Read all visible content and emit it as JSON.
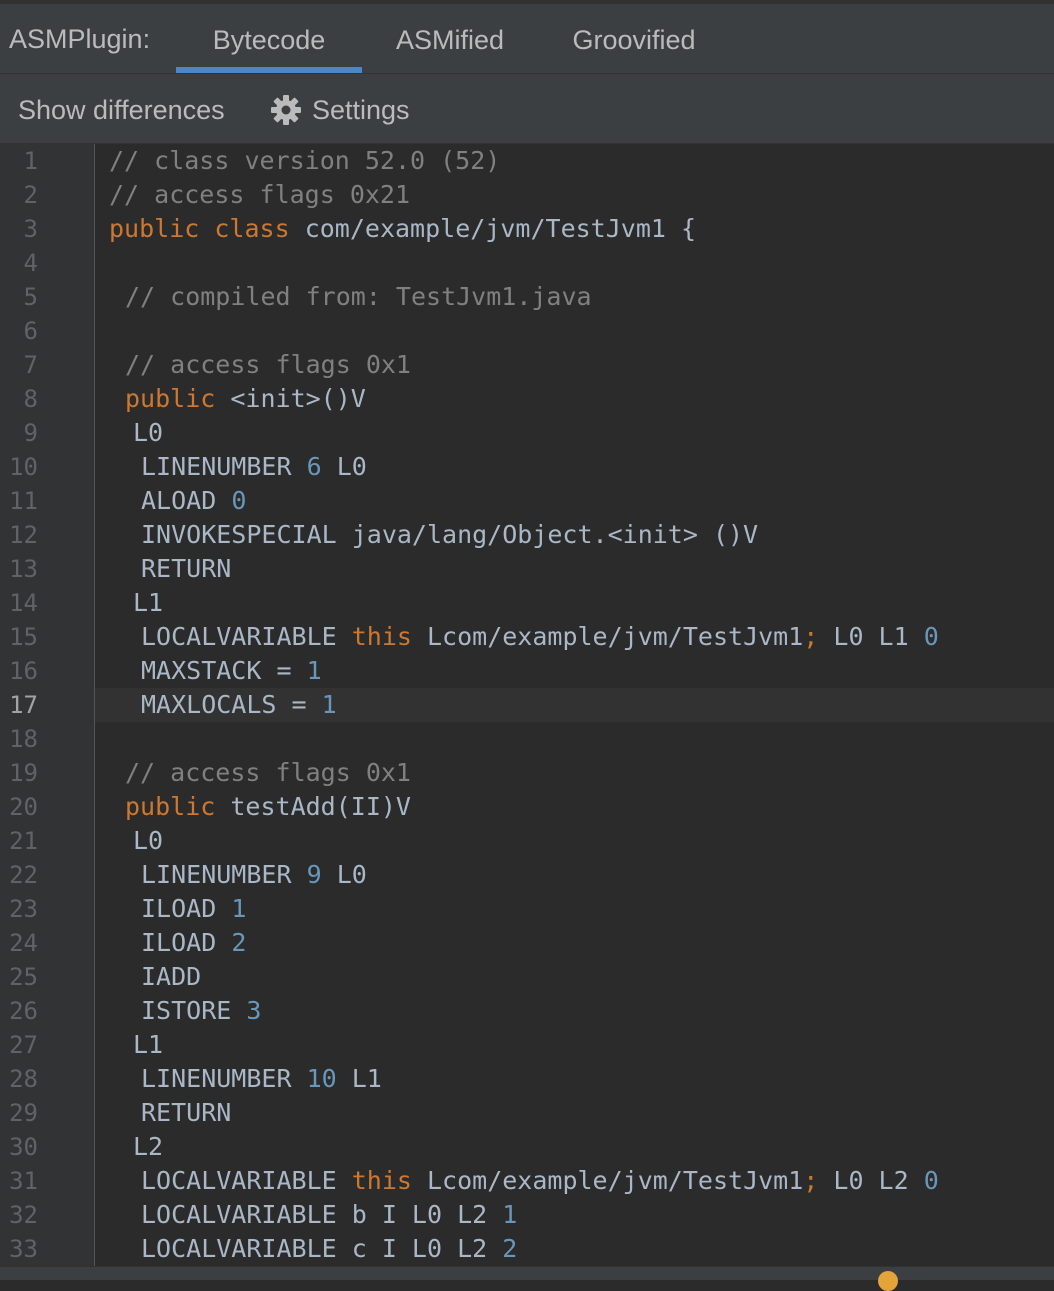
{
  "header": {
    "plugin_label": "ASMPlugin:",
    "tabs": [
      {
        "label": "Bytecode",
        "active": true
      },
      {
        "label": "ASMified",
        "active": false
      },
      {
        "label": "Groovified",
        "active": false
      }
    ]
  },
  "toolbar": {
    "show_differences_label": "Show differences",
    "settings_label": "Settings"
  },
  "editor": {
    "current_line": 17,
    "lines": [
      {
        "n": "1",
        "indent": 0,
        "tokens": [
          {
            "t": "// class version 52.0 (52)",
            "c": "cm"
          }
        ]
      },
      {
        "n": "2",
        "indent": 0,
        "tokens": [
          {
            "t": "// access flags 0x21",
            "c": "cm"
          }
        ]
      },
      {
        "n": "3",
        "indent": 0,
        "tokens": [
          {
            "t": "public",
            "c": "kw"
          },
          {
            "t": " ",
            "c": "tx"
          },
          {
            "t": "class",
            "c": "kw"
          },
          {
            "t": " com/example/jvm/TestJvm1 {",
            "c": "tx"
          }
        ]
      },
      {
        "n": "4",
        "indent": 0,
        "tokens": []
      },
      {
        "n": "5",
        "indent": 2,
        "tokens": [
          {
            "t": "// compiled from: TestJvm1.java",
            "c": "cm"
          }
        ]
      },
      {
        "n": "6",
        "indent": 0,
        "tokens": []
      },
      {
        "n": "7",
        "indent": 2,
        "tokens": [
          {
            "t": "// access flags 0x1",
            "c": "cm"
          }
        ]
      },
      {
        "n": "8",
        "indent": 2,
        "tokens": [
          {
            "t": "public",
            "c": "kw"
          },
          {
            "t": " <init>()V",
            "c": "tx"
          }
        ]
      },
      {
        "n": "9",
        "indent": 3,
        "tokens": [
          {
            "t": "L0",
            "c": "tx"
          }
        ]
      },
      {
        "n": "10",
        "indent": 4,
        "tokens": [
          {
            "t": "LINENUMBER ",
            "c": "tx"
          },
          {
            "t": "6",
            "c": "num"
          },
          {
            "t": " L0",
            "c": "tx"
          }
        ]
      },
      {
        "n": "11",
        "indent": 4,
        "tokens": [
          {
            "t": "ALOAD ",
            "c": "tx"
          },
          {
            "t": "0",
            "c": "num"
          }
        ]
      },
      {
        "n": "12",
        "indent": 4,
        "tokens": [
          {
            "t": "INVOKESPECIAL java/lang/Object.<init> ()V",
            "c": "tx"
          }
        ]
      },
      {
        "n": "13",
        "indent": 4,
        "tokens": [
          {
            "t": "RETURN",
            "c": "tx"
          }
        ]
      },
      {
        "n": "14",
        "indent": 3,
        "tokens": [
          {
            "t": "L1",
            "c": "tx"
          }
        ]
      },
      {
        "n": "15",
        "indent": 4,
        "tokens": [
          {
            "t": "LOCALVARIABLE ",
            "c": "tx"
          },
          {
            "t": "this",
            "c": "kw"
          },
          {
            "t": " Lcom/example/jvm/TestJvm1",
            "c": "tx"
          },
          {
            "t": ";",
            "c": "kw"
          },
          {
            "t": " L0 L1 ",
            "c": "tx"
          },
          {
            "t": "0",
            "c": "num"
          }
        ]
      },
      {
        "n": "16",
        "indent": 4,
        "tokens": [
          {
            "t": "MAXSTACK = ",
            "c": "tx"
          },
          {
            "t": "1",
            "c": "num"
          }
        ]
      },
      {
        "n": "17",
        "indent": 4,
        "tokens": [
          {
            "t": "MAXLOCALS = ",
            "c": "tx"
          },
          {
            "t": "1",
            "c": "num"
          }
        ]
      },
      {
        "n": "18",
        "indent": 0,
        "tokens": []
      },
      {
        "n": "19",
        "indent": 2,
        "tokens": [
          {
            "t": "// access flags 0x1",
            "c": "cm"
          }
        ]
      },
      {
        "n": "20",
        "indent": 2,
        "tokens": [
          {
            "t": "public",
            "c": "kw"
          },
          {
            "t": " testAdd(II)V",
            "c": "tx"
          }
        ]
      },
      {
        "n": "21",
        "indent": 3,
        "tokens": [
          {
            "t": "L0",
            "c": "tx"
          }
        ]
      },
      {
        "n": "22",
        "indent": 4,
        "tokens": [
          {
            "t": "LINENUMBER ",
            "c": "tx"
          },
          {
            "t": "9",
            "c": "num"
          },
          {
            "t": " L0",
            "c": "tx"
          }
        ]
      },
      {
        "n": "23",
        "indent": 4,
        "tokens": [
          {
            "t": "ILOAD ",
            "c": "tx"
          },
          {
            "t": "1",
            "c": "num"
          }
        ]
      },
      {
        "n": "24",
        "indent": 4,
        "tokens": [
          {
            "t": "ILOAD ",
            "c": "tx"
          },
          {
            "t": "2",
            "c": "num"
          }
        ]
      },
      {
        "n": "25",
        "indent": 4,
        "tokens": [
          {
            "t": "IADD",
            "c": "tx"
          }
        ]
      },
      {
        "n": "26",
        "indent": 4,
        "tokens": [
          {
            "t": "ISTORE ",
            "c": "tx"
          },
          {
            "t": "3",
            "c": "num"
          }
        ]
      },
      {
        "n": "27",
        "indent": 3,
        "tokens": [
          {
            "t": "L1",
            "c": "tx"
          }
        ]
      },
      {
        "n": "28",
        "indent": 4,
        "tokens": [
          {
            "t": "LINENUMBER ",
            "c": "tx"
          },
          {
            "t": "10",
            "c": "num"
          },
          {
            "t": " L1",
            "c": "tx"
          }
        ]
      },
      {
        "n": "29",
        "indent": 4,
        "tokens": [
          {
            "t": "RETURN",
            "c": "tx"
          }
        ]
      },
      {
        "n": "30",
        "indent": 3,
        "tokens": [
          {
            "t": "L2",
            "c": "tx"
          }
        ]
      },
      {
        "n": "31",
        "indent": 4,
        "tokens": [
          {
            "t": "LOCALVARIABLE ",
            "c": "tx"
          },
          {
            "t": "this",
            "c": "kw"
          },
          {
            "t": " Lcom/example/jvm/TestJvm1",
            "c": "tx"
          },
          {
            "t": ";",
            "c": "kw"
          },
          {
            "t": " L0 L2 ",
            "c": "tx"
          },
          {
            "t": "0",
            "c": "num"
          }
        ]
      },
      {
        "n": "32",
        "indent": 4,
        "tokens": [
          {
            "t": "LOCALVARIABLE b I L0 L2 ",
            "c": "tx"
          },
          {
            "t": "1",
            "c": "num"
          }
        ]
      },
      {
        "n": "33",
        "indent": 4,
        "tokens": [
          {
            "t": "LOCALVARIABLE c I L0 L2 ",
            "c": "tx"
          },
          {
            "t": "2",
            "c": "num"
          }
        ]
      }
    ]
  },
  "colors": {
    "background": "#2b2b2b",
    "panel": "#3c3f41",
    "accent": "#4a88c7",
    "keyword": "#cc7832",
    "number": "#6897bb",
    "comment": "#808080",
    "text": "#a9b7c6"
  },
  "icons": {
    "settings": "gear-icon"
  }
}
